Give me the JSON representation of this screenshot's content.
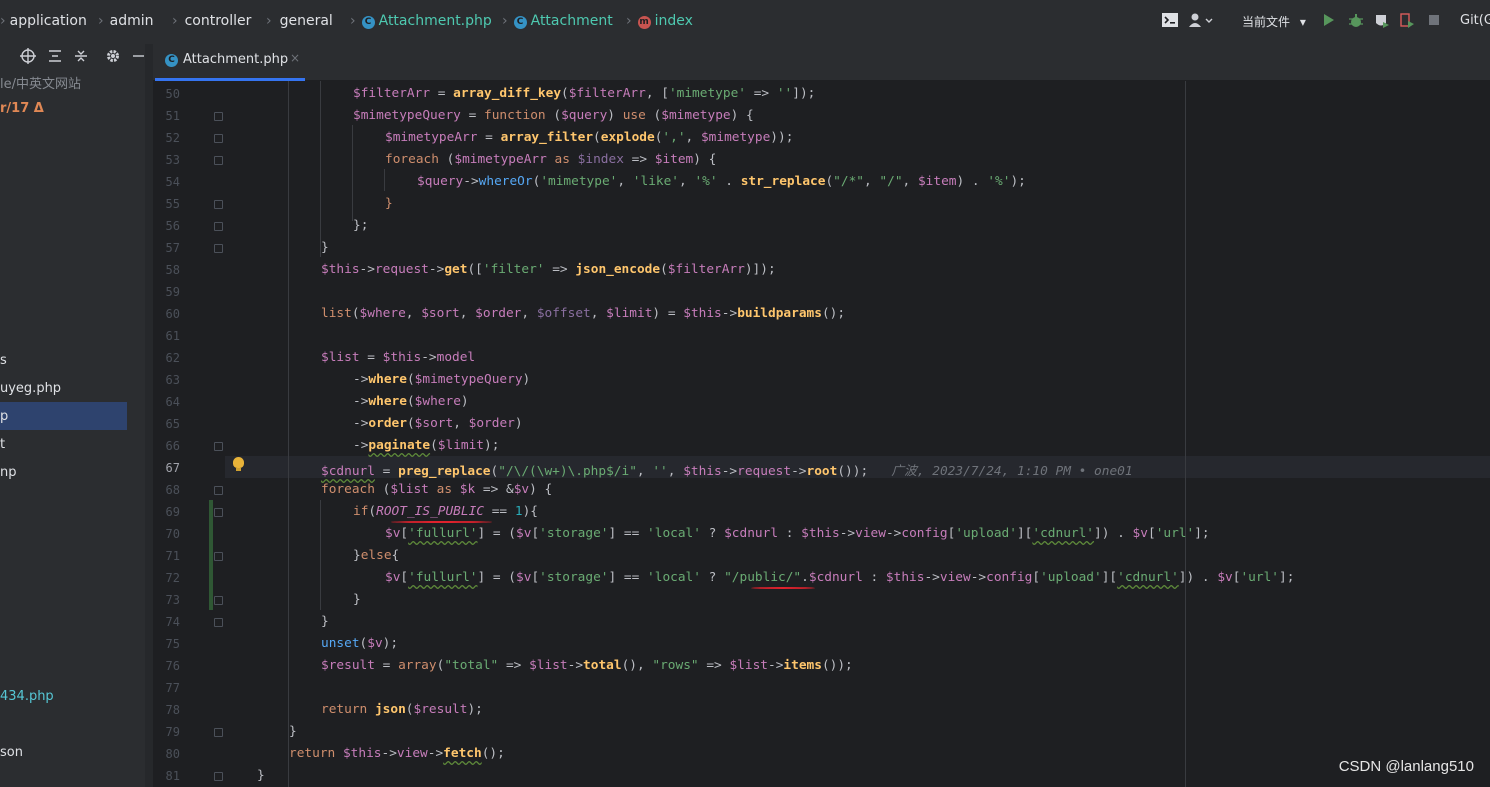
{
  "breadcrumbs": [
    {
      "label": "application"
    },
    {
      "label": "admin"
    },
    {
      "label": "controller"
    },
    {
      "label": "general"
    },
    {
      "label": "Attachment.php",
      "badge": "C"
    },
    {
      "label": "Attachment",
      "badge": "C"
    },
    {
      "label": "index",
      "badge": "m"
    }
  ],
  "toolbar": {
    "scope_label": "当前文件",
    "git_label": "Git(G"
  },
  "project_panel": {
    "path_fragment": "le/中英文网站",
    "branch_fragment": "r/17 Δ",
    "items": [
      "s",
      "uyeg.php",
      "p",
      "t",
      "np",
      "434.php",
      "son"
    ]
  },
  "tab": {
    "label": "Attachment.php",
    "close": "×"
  },
  "editor": {
    "current_line": 67,
    "line_numbers": [
      50,
      51,
      52,
      53,
      54,
      55,
      56,
      57,
      58,
      59,
      60,
      61,
      62,
      63,
      64,
      65,
      66,
      67,
      68,
      69,
      70,
      71,
      72,
      73,
      74,
      75,
      76,
      77,
      78,
      79,
      80,
      81
    ],
    "blame_annotation": "广波, 2023/7/24, 1:10 PM • one01"
  },
  "watermark": "CSDN @lanlang510",
  "colors": {
    "editor_bg": "#1e1f22",
    "panel_bg": "#2b2d30",
    "keyword": "#cf8e6d",
    "variable": "#c77dbb",
    "string": "#6aab73",
    "function": "#56a8f5",
    "annotation_red": "#e0222d"
  },
  "icons": [
    "terminal-icon",
    "user-icon",
    "run-icon",
    "debug-icon",
    "coverage-icon",
    "profile-icon",
    "stop-icon",
    "locate-icon",
    "collapse-icon",
    "expand-icon",
    "settings-icon",
    "minimize-icon",
    "bulb-icon"
  ]
}
